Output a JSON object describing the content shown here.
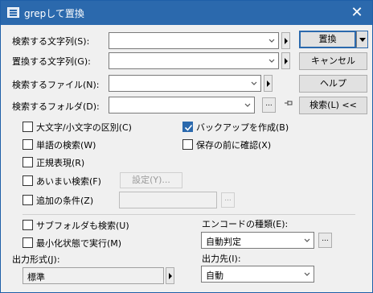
{
  "window": {
    "title": "grepして置換"
  },
  "fields": {
    "search_string_label": "検索する文字列(S):",
    "replace_string_label": "置換する文字列(G):",
    "search_file_label": "検索するファイル(N):",
    "search_folder_label": "検索するフォルダ(D):"
  },
  "buttons": {
    "replace": "置換",
    "cancel": "キャンセル",
    "help": "ヘルプ",
    "search": "検索(L) <<",
    "settings": "設定(Y)...",
    "ellipsis": "..."
  },
  "options": {
    "case_sensitive": "大文字/小文字の区別(C)",
    "word_search": "単語の検索(W)",
    "regex": "正規表現(R)",
    "fuzzy": "あいまい検索(F)",
    "extra_condition": "追加の条件(Z)",
    "backup": "バックアップを作成(B)",
    "confirm_before_save": "保存の前に確認(X)",
    "subfolders": "サブフォルダも検索(U)",
    "minimized": "最小化状態で実行(M)"
  },
  "checked": {
    "backup": true
  },
  "encoding": {
    "label": "エンコードの種類(E):",
    "value": "自動判定"
  },
  "output_format": {
    "label": "出力形式(J):",
    "value": "標準"
  },
  "output_dest": {
    "label": "出力先(I):",
    "value": "自動"
  }
}
